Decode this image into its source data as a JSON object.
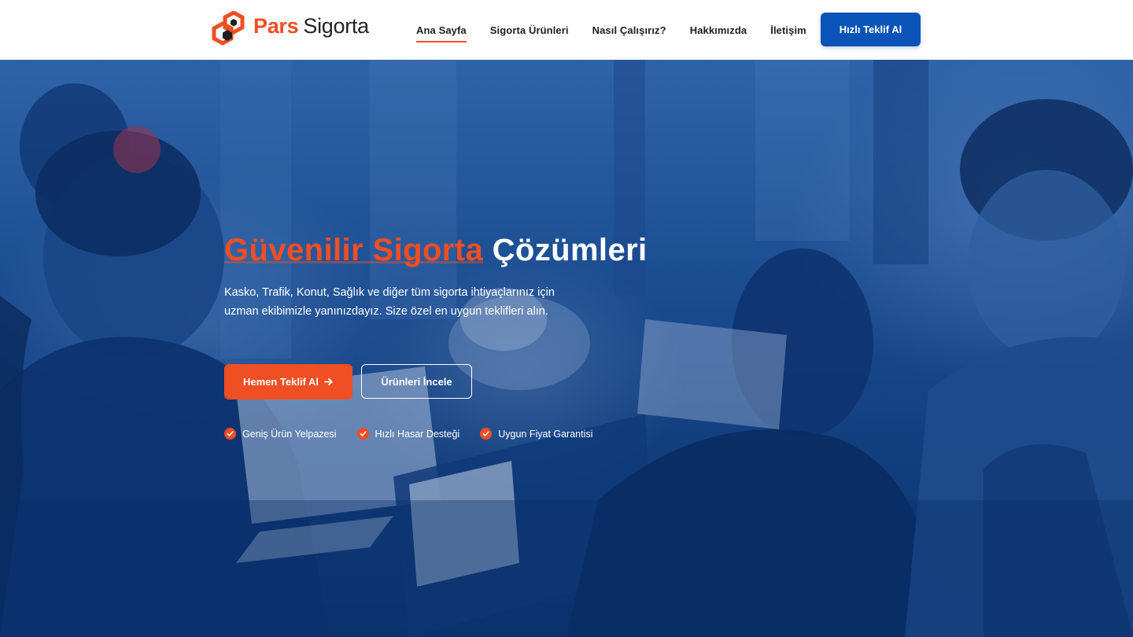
{
  "header": {
    "logo": {
      "brand_primary": "Pars",
      "brand_secondary": "Sigorta",
      "icon": "hexagon-logo-icon"
    },
    "nav": [
      {
        "label": "Ana Sayfa",
        "active": true
      },
      {
        "label": "Sigorta Ürünleri",
        "active": false
      },
      {
        "label": "Nasıl Çalışırız?",
        "active": false
      },
      {
        "label": "Hakkımızda",
        "active": false
      },
      {
        "label": "İletişim",
        "active": false
      }
    ],
    "cta_label": "Hızlı Teklif Al"
  },
  "hero": {
    "title_accent": "Güvenilir Sigorta",
    "title_rest": "Çözümleri",
    "description": "Kasko, Trafik, Konut, Sağlık ve diğer tüm sigorta ihtiyaçlarınız için uzman ekibimizle yanınızdayız. Size özel en uygun teklifleri alın.",
    "primary_button": "Hemen Teklif Al",
    "primary_button_icon": "arrow-right-icon",
    "secondary_button": "Ürünleri İncele",
    "features": [
      "Geniş Ürün Yelpazesi",
      "Hızlı Hasar Desteği",
      "Uygun Fiyat Garantisi"
    ],
    "feature_icon": "check-circle-icon"
  },
  "colors": {
    "accent": "#f04e23",
    "primary_blue": "#0a53b8",
    "overlay_blue": "#1d4f93",
    "text_dark": "#1e1e1e"
  }
}
